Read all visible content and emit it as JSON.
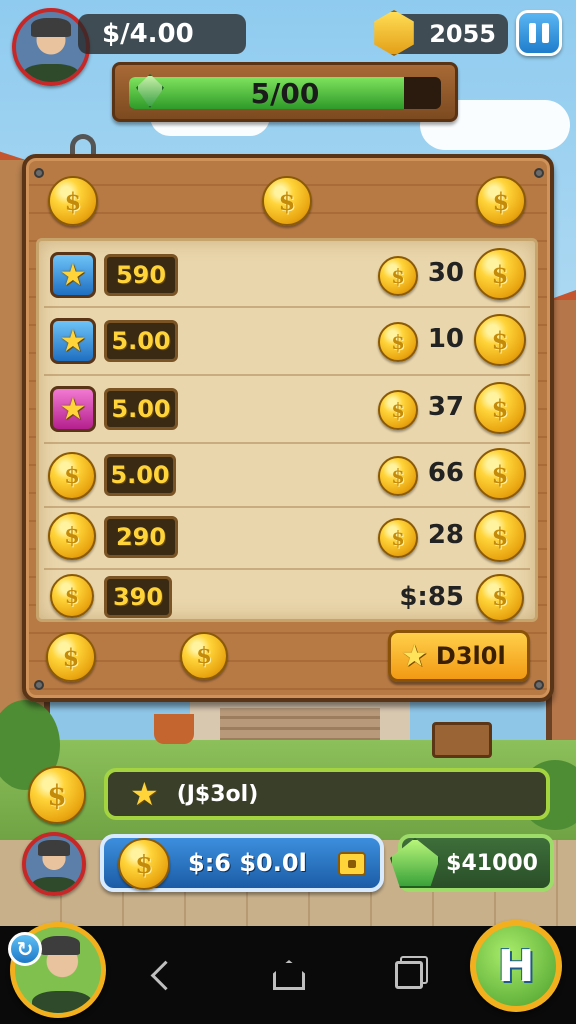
{
  "hud": {
    "cash": "$/4.00",
    "gems": "2055",
    "progress": {
      "label": "5/00",
      "fill_fraction": 0.88
    }
  },
  "shop": {
    "rows": [
      {
        "icon": "star-icon",
        "icon_color": "blue",
        "price": "590",
        "reward": "30"
      },
      {
        "icon": "star-icon",
        "icon_color": "blue",
        "price": "5.00",
        "reward": "10"
      },
      {
        "icon": "star-icon",
        "icon_color": "pink",
        "price": "5.00",
        "reward": "37"
      },
      {
        "icon": "coin-icon",
        "icon_color": "gold",
        "price": "5.00",
        "reward": "66"
      },
      {
        "icon": "coin-icon",
        "icon_color": "gold",
        "price": "290",
        "reward": "28"
      },
      {
        "icon": "coin-icon",
        "icon_color": "gold",
        "price": "390",
        "reward": "$:85"
      }
    ],
    "deal_button": "D3l0l"
  },
  "quest": {
    "label": "(J$3ol)"
  },
  "balance": {
    "label": "$:6 $0.0l"
  },
  "earnings": {
    "label": "$41000"
  },
  "help_button": "H",
  "colors": {
    "wood": "#b87a44",
    "parchment": "#ead6ac",
    "gold": "#ffd43a",
    "progress_green": "#2f9a2a",
    "accent_blue": "#1f7dcc"
  }
}
